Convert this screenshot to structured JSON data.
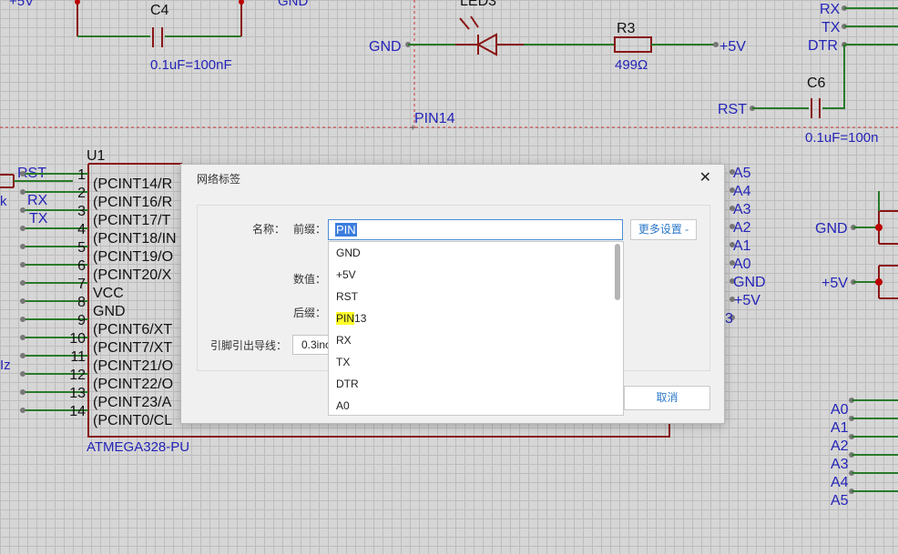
{
  "schematic": {
    "top_left": {
      "c4_label": "C4",
      "c4_value": "0.1uF=100nF",
      "plus5": "+5V",
      "gnd": "GND"
    },
    "top_center": {
      "led_label": "LED3",
      "gnd": "GND",
      "r3_label": "R3",
      "r3_value": "499Ω",
      "plus5": "+5V",
      "net_label": "PIN14"
    },
    "top_right": {
      "rx": "RX",
      "tx": "TX",
      "dtr": "DTR",
      "rst": "RST",
      "c6_label": "C6",
      "c6_value": "0.1uF=100n"
    },
    "chip": {
      "ref": "U1",
      "part": "ATMEGA328-PU",
      "left_nets": {
        "rst": "RST",
        "rx": "RX",
        "tx": "TX",
        "k": "k",
        "iz": "Iz"
      },
      "pins": [
        {
          "num": "1",
          "name": "(PCINT14/R"
        },
        {
          "num": "2",
          "name": "(PCINT16/R"
        },
        {
          "num": "3",
          "name": "(PCINT17/T"
        },
        {
          "num": "4",
          "name": "(PCINT18/IN"
        },
        {
          "num": "5",
          "name": "(PCINT19/O"
        },
        {
          "num": "6",
          "name": "(PCINT20/X"
        },
        {
          "num": "7",
          "name": "VCC"
        },
        {
          "num": "8",
          "name": "GND"
        },
        {
          "num": "9",
          "name": "(PCINT6/XT"
        },
        {
          "num": "10",
          "name": "(PCINT7/XT"
        },
        {
          "num": "11",
          "name": "(PCINT21/O"
        },
        {
          "num": "12",
          "name": "(PCINT22/O"
        },
        {
          "num": "13",
          "name": "(PCINT23/A"
        },
        {
          "num": "14",
          "name": "(PCINT0/CL"
        }
      ],
      "right_nets": [
        "A5",
        "A4",
        "A3",
        "A2",
        "A1",
        "A0",
        "GND",
        "+5V",
        "3"
      ]
    },
    "right_side": {
      "gnd": "GND",
      "plus5": "+5V",
      "analog": [
        "A0",
        "A1",
        "A2",
        "A3",
        "A4",
        "A5"
      ]
    }
  },
  "dialog": {
    "title": "网络标签",
    "close_label": "✕",
    "name_label": "名称：",
    "prefix_label": "前缀：",
    "prefix_value": "PIN",
    "more_settings": "更多设置 -",
    "number_label": "数值：",
    "suffix_label": "后缀：",
    "pin_lead_label": "引脚引出导线：",
    "pin_lead_value": "0.3inc",
    "cancel": "取消",
    "dropdown": {
      "items": [
        "GND",
        "+5V",
        "RST",
        "PIN13",
        "RX",
        "TX",
        "DTR",
        "A0"
      ],
      "highlight": {
        "match": "PIN",
        "rest": "13"
      }
    }
  },
  "colors": {
    "net_blue": "#2424b8",
    "wire_green": "#2a7a2a",
    "part_red": "#8a1616",
    "highlight": "#ffff2a",
    "selection": "#3b7ddd"
  }
}
